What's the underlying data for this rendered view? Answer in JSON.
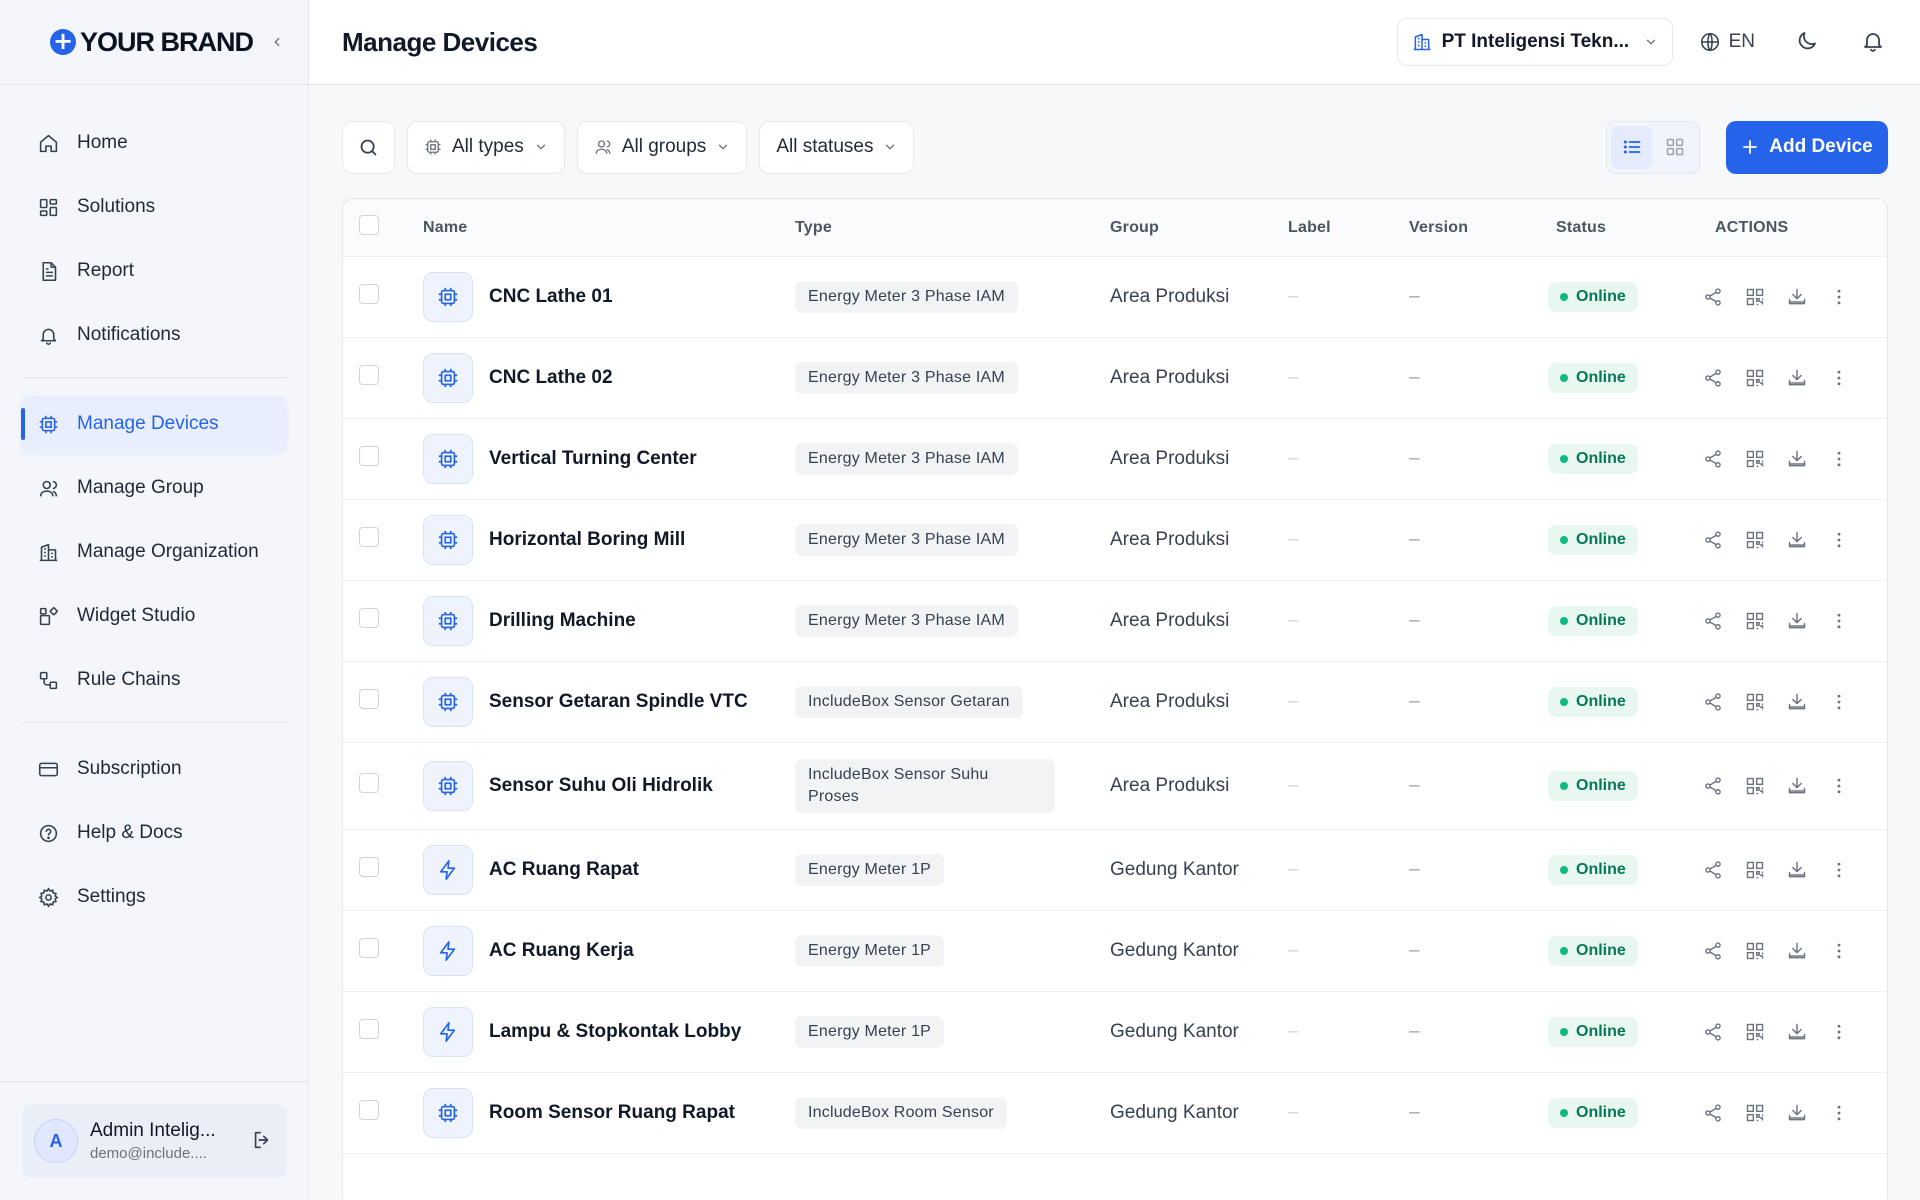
{
  "brand": {
    "name": "YOUR BRAND",
    "plus": "+"
  },
  "header": {
    "title": "Manage Devices",
    "org": "PT Inteligensi Tekn...",
    "lang": "EN"
  },
  "sidebar": {
    "items": [
      {
        "label": "Home",
        "icon": "home-icon"
      },
      {
        "label": "Solutions",
        "icon": "grid-icon"
      },
      {
        "label": "Report",
        "icon": "file-icon"
      },
      {
        "label": "Notifications",
        "icon": "bell-icon"
      },
      {
        "label": "Manage Devices",
        "icon": "cpu-icon",
        "active": true
      },
      {
        "label": "Manage Group",
        "icon": "users-icon"
      },
      {
        "label": "Manage Organization",
        "icon": "building-icon"
      },
      {
        "label": "Widget Studio",
        "icon": "widgets-icon"
      },
      {
        "label": "Rule Chains",
        "icon": "workflow-icon"
      },
      {
        "label": "Subscription",
        "icon": "card-icon"
      },
      {
        "label": "Help & Docs",
        "icon": "help-icon"
      },
      {
        "label": "Settings",
        "icon": "gear-icon"
      }
    ],
    "user": {
      "initial": "A",
      "name": "Admin Intelig...",
      "email": "demo@include...."
    }
  },
  "toolbar": {
    "filter_types": "All types",
    "filter_groups": "All groups",
    "filter_statuses": "All statuses",
    "add_label": "Add Device"
  },
  "table": {
    "columns": {
      "name": "Name",
      "type": "Type",
      "group": "Group",
      "label": "Label",
      "version": "Version",
      "status": "Status",
      "actions": "ACTIONS"
    },
    "rows": [
      {
        "name": "CNC Lathe 01",
        "type": "Energy Meter 3 Phase IAM",
        "group": "Area Produksi",
        "label": "–",
        "version": "–",
        "status": "Online",
        "icon": "cpu"
      },
      {
        "name": "CNC Lathe 02",
        "type": "Energy Meter 3 Phase IAM",
        "group": "Area Produksi",
        "label": "–",
        "version": "–",
        "status": "Online",
        "icon": "cpu"
      },
      {
        "name": "Vertical Turning Center",
        "type": "Energy Meter 3 Phase IAM",
        "group": "Area Produksi",
        "label": "–",
        "version": "–",
        "status": "Online",
        "icon": "cpu"
      },
      {
        "name": "Horizontal Boring Mill",
        "type": "Energy Meter 3 Phase IAM",
        "group": "Area Produksi",
        "label": "–",
        "version": "–",
        "status": "Online",
        "icon": "cpu"
      },
      {
        "name": "Drilling Machine",
        "type": "Energy Meter 3 Phase IAM",
        "group": "Area Produksi",
        "label": "–",
        "version": "–",
        "status": "Online",
        "icon": "cpu"
      },
      {
        "name": "Sensor Getaran Spindle VTC",
        "type": "IncludeBox Sensor Getaran",
        "group": "Area Produksi",
        "label": "–",
        "version": "–",
        "status": "Online",
        "icon": "cpu"
      },
      {
        "name": "Sensor Suhu Oli Hidrolik",
        "type": "IncludeBox Sensor Suhu Proses",
        "group": "Area Produksi",
        "label": "–",
        "version": "–",
        "status": "Online",
        "icon": "cpu"
      },
      {
        "name": "AC Ruang Rapat",
        "type": "Energy Meter 1P",
        "group": "Gedung Kantor",
        "label": "–",
        "version": "–",
        "status": "Online",
        "icon": "bolt"
      },
      {
        "name": "AC Ruang Kerja",
        "type": "Energy Meter 1P",
        "group": "Gedung Kantor",
        "label": "–",
        "version": "–",
        "status": "Online",
        "icon": "bolt"
      },
      {
        "name": "Lampu & Stopkontak Lobby",
        "type": "Energy Meter 1P",
        "group": "Gedung Kantor",
        "label": "–",
        "version": "–",
        "status": "Online",
        "icon": "bolt"
      },
      {
        "name": "Room Sensor Ruang Rapat",
        "type": "IncludeBox Room Sensor",
        "group": "Gedung Kantor",
        "label": "–",
        "version": "–",
        "status": "Online",
        "icon": "cpu"
      }
    ]
  },
  "colors": {
    "accent": "#2563eb",
    "online_bg": "#e8f7ef",
    "online_text": "#047857",
    "online_dot": "#10b981"
  }
}
